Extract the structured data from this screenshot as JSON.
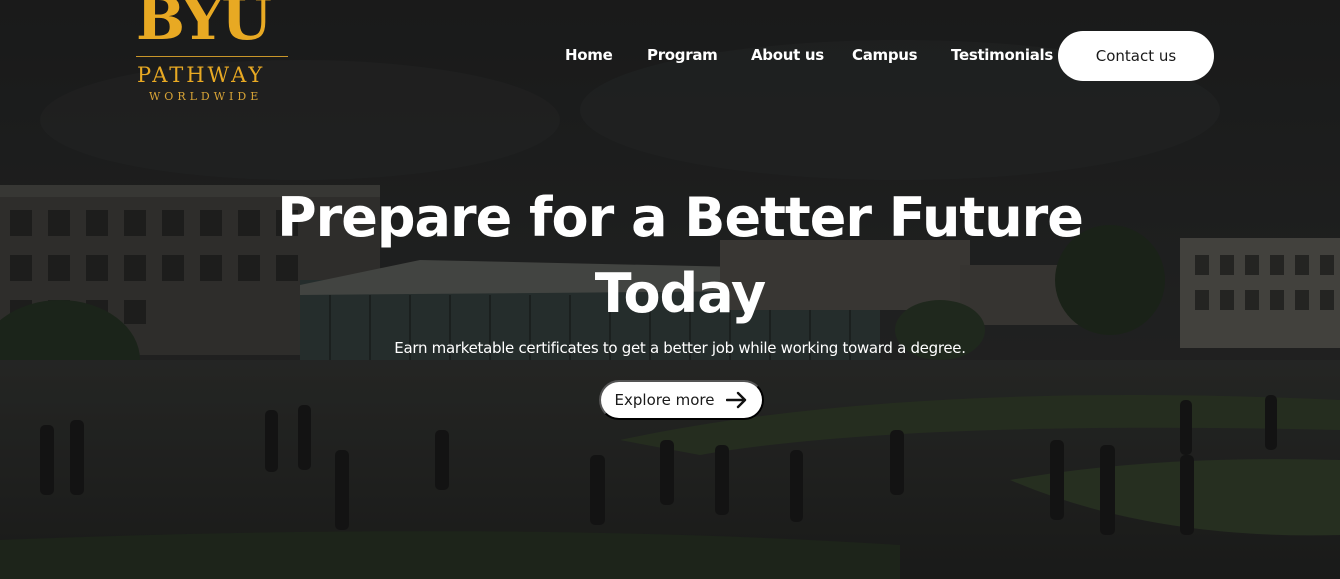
{
  "logo": {
    "wordmark": "BYU",
    "line1": "PATHWAY",
    "line2": "WORLDWIDE",
    "color": "#e8a923"
  },
  "nav": {
    "items": [
      "Home",
      "Program",
      "About us",
      "Campus",
      "Testimonials"
    ],
    "contact_label": "Contact us"
  },
  "hero": {
    "headline_line1": "Prepare for a Better Future",
    "headline_line2": "Today",
    "subtitle": "Earn marketable certificates to get a better job while working toward a degree.",
    "cta_label": "Explore more",
    "cta_icon": "arrow-right-icon",
    "background": "campus-photo-students-walking"
  }
}
